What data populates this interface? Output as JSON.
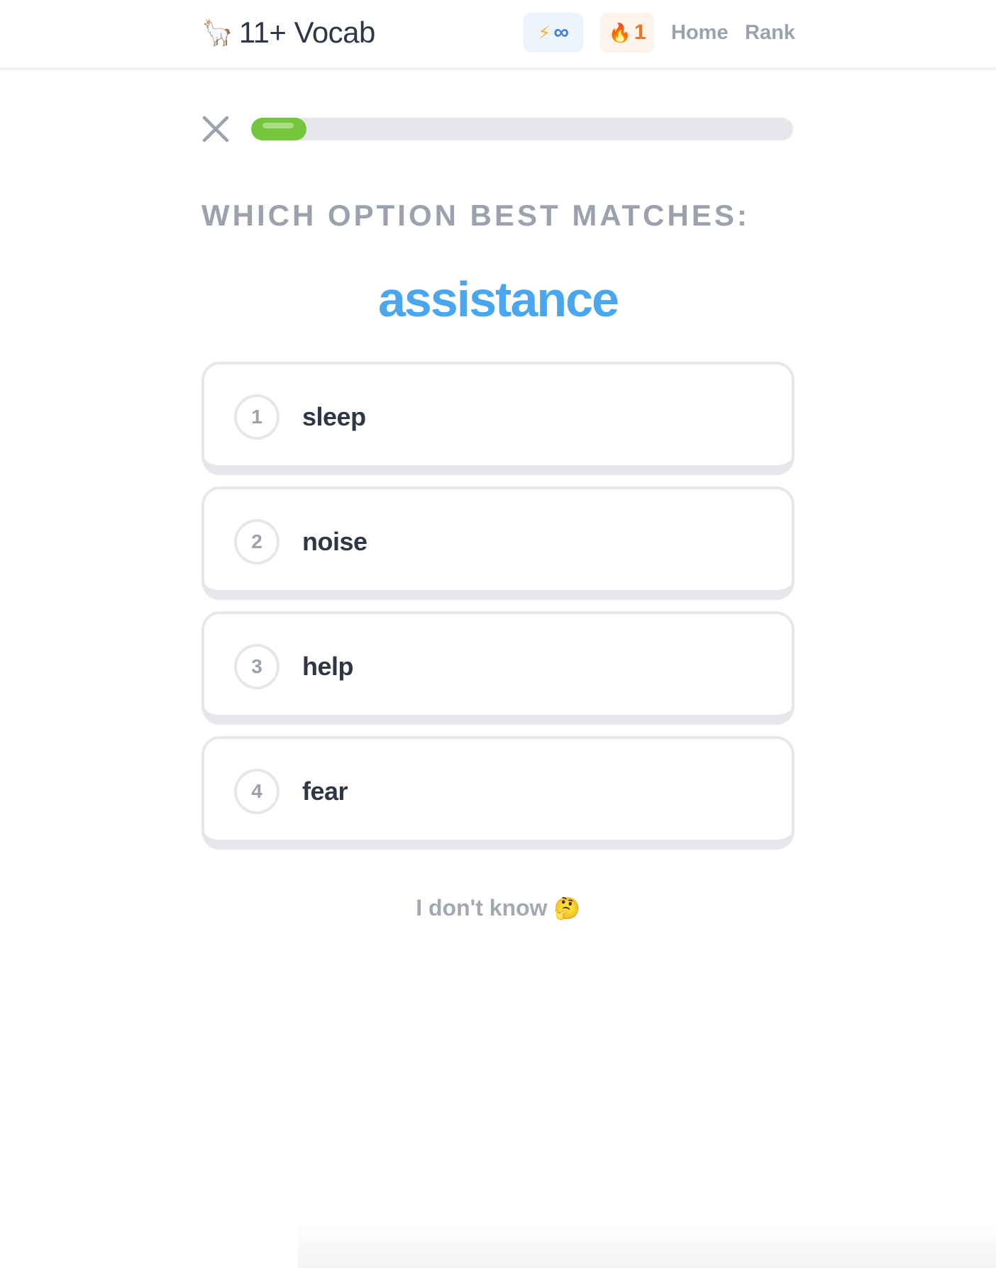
{
  "header": {
    "logo_emoji": "🦙",
    "title": "11+ Vocab",
    "energy": {
      "icon": "⚡",
      "value": "∞"
    },
    "streak": {
      "icon": "🔥",
      "value": "1"
    },
    "nav": {
      "home": "Home",
      "rank": "Rank"
    }
  },
  "quiz": {
    "progress_fraction": 0.1,
    "prompt": "WHICH OPTION BEST MATCHES:",
    "word": "assistance",
    "options": [
      {
        "number": "1",
        "label": "sleep"
      },
      {
        "number": "2",
        "label": "noise"
      },
      {
        "number": "3",
        "label": "help"
      },
      {
        "number": "4",
        "label": "fear"
      }
    ],
    "dont_know": {
      "label": "I don't know",
      "emoji": "🤔"
    }
  },
  "colors": {
    "accent_blue": "#4aa6ee",
    "progress_green": "#74c73d",
    "text_dark": "#2f3747",
    "text_muted": "#9ca2ad",
    "border": "#e5e7ea"
  }
}
